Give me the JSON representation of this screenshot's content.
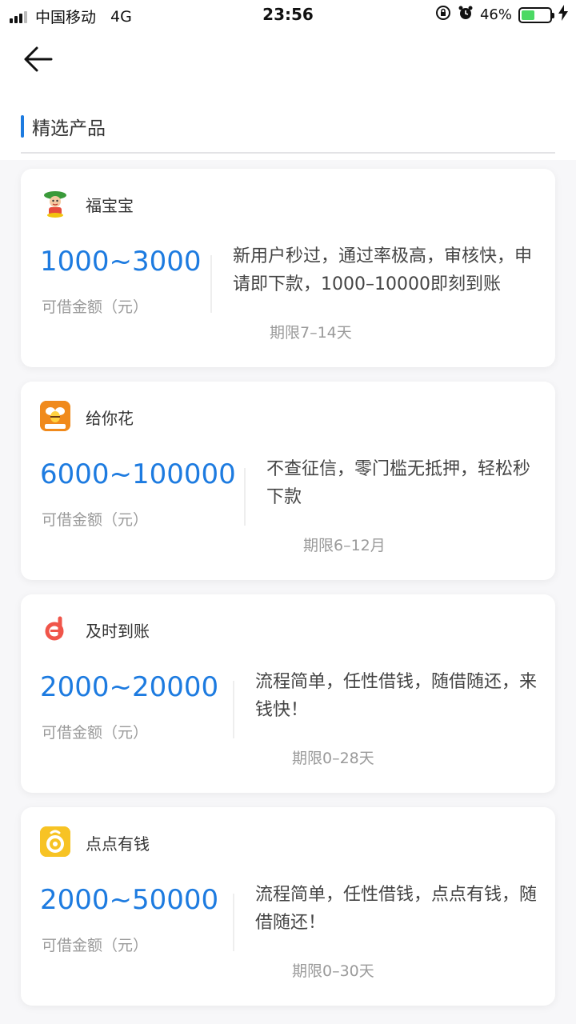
{
  "status": {
    "carrier": "中国移动",
    "network": "4G",
    "time": "23:56",
    "battery": "46%",
    "battery_level": 0.46
  },
  "section": {
    "title": "精选产品"
  },
  "products": [
    {
      "name": "福宝宝",
      "amount": "1000~3000",
      "amount_label": "可借金额（元）",
      "desc": "新用户秒过，通过率极高，审核快，申请即下款，1000–10000即刻到账",
      "term": "期限7–14天",
      "logo_icon": "mascot-icon"
    },
    {
      "name": "给你花",
      "amount": "6000~100000",
      "amount_label": "可借金额（元）",
      "desc": "不查征信，零门槛无抵押，轻松秒下款",
      "term": "期限6–12月",
      "logo_icon": "bee-icon"
    },
    {
      "name": "及时到账",
      "amount": "2000~20000",
      "amount_label": "可借金额（元）",
      "desc": "流程简单，任性借钱，随借随还，来钱快！",
      "term": "期限0–28天",
      "logo_icon": "d-letter-icon"
    },
    {
      "name": "点点有钱",
      "amount": "2000~50000",
      "amount_label": "可借金额（元）",
      "desc": "流程简单，任性借钱，点点有钱，随借随还！",
      "term": "期限0–30天",
      "logo_icon": "coin-icon"
    }
  ],
  "colors": {
    "accent": "#1d7be0",
    "battery": "#4cd964"
  }
}
